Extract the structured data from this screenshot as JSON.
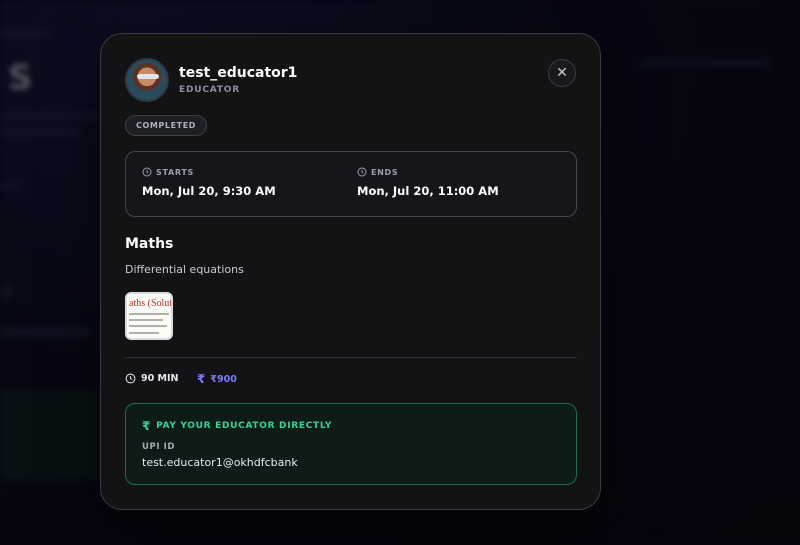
{
  "educator": {
    "name": "test_educator1",
    "role": "EDUCATOR"
  },
  "status": "COMPLETED",
  "schedule": {
    "starts_label": "STARTS",
    "starts_value": "Mon, Jul 20, 9:30 AM",
    "ends_label": "ENDS",
    "ends_value": "Mon, Jul 20, 11:00 AM"
  },
  "session": {
    "subject": "Maths",
    "topic": "Differential equations",
    "attachment_title": "aths (Solutio"
  },
  "meta": {
    "duration": "90 MIN",
    "price": "₹900"
  },
  "payment": {
    "heading": "PAY YOUR EDUCATOR DIRECTLY",
    "upi_label": "UPI ID",
    "upi_value": "test.educator1@okhdfcbank"
  },
  "icons": {
    "close": "close-icon",
    "clock": "clock-icon",
    "rupee": "rupee-icon"
  },
  "colors": {
    "accent_green": "#2fd59a",
    "price": "#7d7bff",
    "modal_bg": "#131316"
  }
}
